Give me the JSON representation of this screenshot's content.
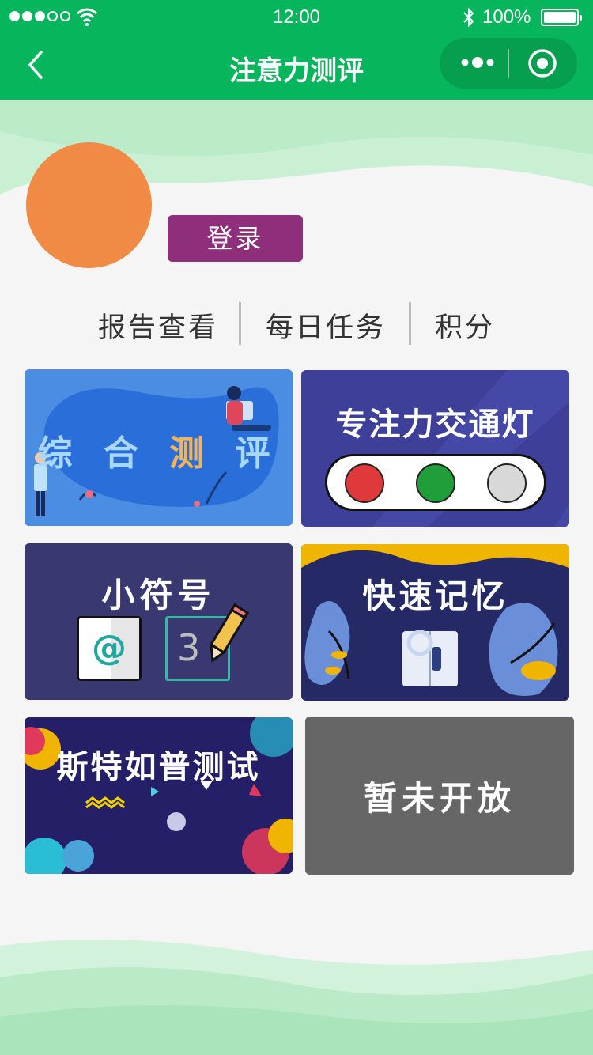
{
  "status_bar": {
    "time": "12:00",
    "battery": "100%",
    "signal_dots_filled": 3,
    "signal_dots_total": 5
  },
  "nav": {
    "title": "注意力测评"
  },
  "profile": {
    "avatar_color": "#f08a44",
    "login_label": "登录"
  },
  "tabs": [
    {
      "label": "报告查看"
    },
    {
      "label": "每日任务"
    },
    {
      "label": "积分"
    }
  ],
  "cards": {
    "comprehensive": {
      "label_parts": [
        "综 合 ",
        "测",
        " 评"
      ]
    },
    "traffic_light": {
      "label": "专注力交通灯",
      "lights": [
        "#e0393b",
        "#1f9e3a",
        "#d8d8d8"
      ]
    },
    "symbols": {
      "label": "小符号",
      "symbol_at": "@",
      "symbol_num": "3"
    },
    "memory": {
      "label": "快速记忆"
    },
    "stroop": {
      "label": "斯特如普测试"
    },
    "closed": {
      "label": "暂未开放"
    }
  },
  "colors": {
    "brand_green": "#07b65c",
    "login_purple": "#8f2f7c",
    "closed_gray": "#666666"
  }
}
